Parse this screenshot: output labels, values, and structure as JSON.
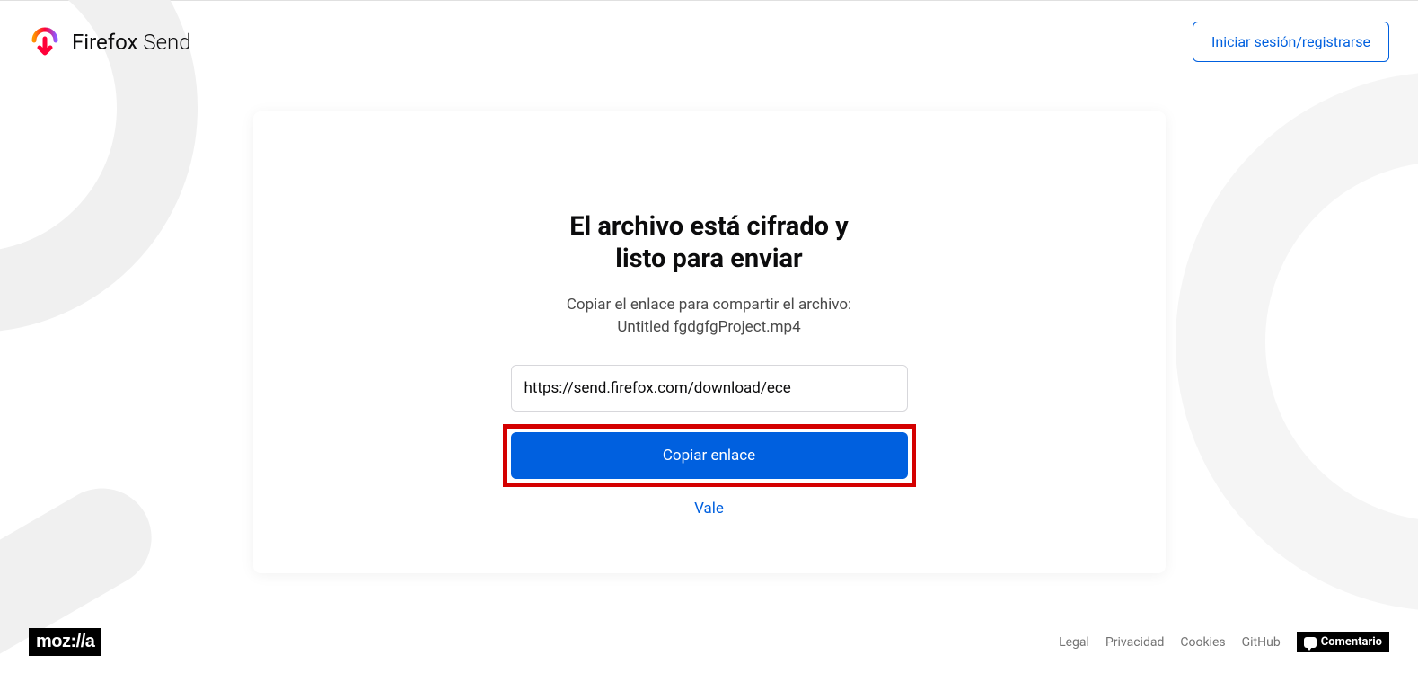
{
  "header": {
    "brand_first": "Firefox",
    "brand_second": "Send",
    "signin_label": "Iniciar sesión/registrarse"
  },
  "card": {
    "title_line1": "El archivo está cifrado y",
    "title_line2": "listo para enviar",
    "subtext_line1": "Copiar el enlace para compartir el archivo:",
    "subtext_filename": "Untitled fgdgfgProject.mp4",
    "share_url": "https://send.firefox.com/download/ece",
    "copy_button_label": "Copiar enlace",
    "ok_label": "Vale"
  },
  "footer": {
    "mozilla_label": "moz://a",
    "links": {
      "legal": "Legal",
      "privacy": "Privacidad",
      "cookies": "Cookies",
      "github": "GitHub"
    },
    "feedback_label": "Comentario"
  }
}
